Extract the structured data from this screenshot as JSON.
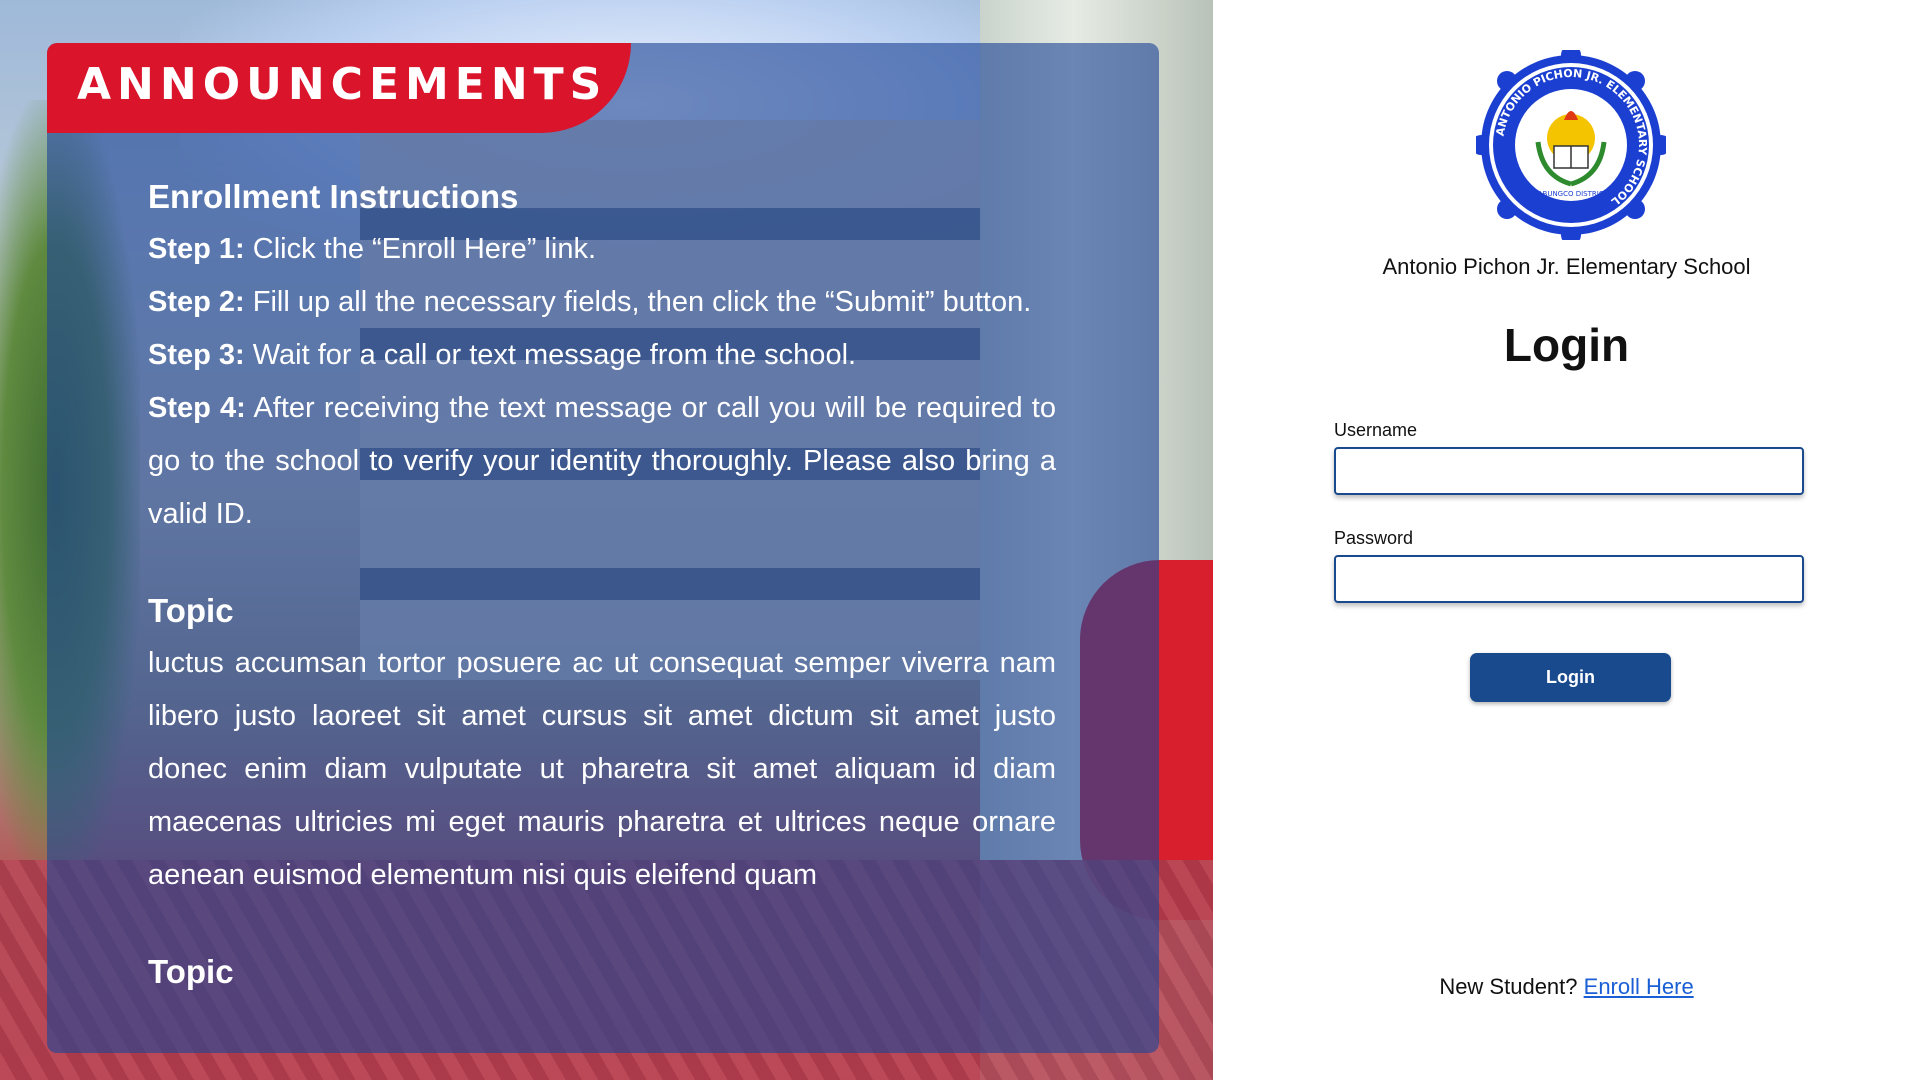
{
  "announcements": {
    "title": "ANNOUNCEMENTS",
    "enrollment": {
      "heading": "Enrollment Instructions",
      "steps": [
        {
          "label": "Step 1:",
          "text": " Click the “Enroll Here” link."
        },
        {
          "label": "Step 2:",
          "text": " Fill up all the necessary fields, then click the “Submit” button."
        },
        {
          "label": "Step 3:",
          "text": " Wait for a call or text message from the school."
        },
        {
          "label": "Step 4:",
          "text": " After receiving the text message or call you will be required to go to the school to verify your identity thoroughly. Please also bring a valid ID."
        }
      ]
    },
    "topics": [
      {
        "heading": "Topic",
        "body": "luctus accumsan tortor posuere ac ut consequat semper viverra nam libero justo laoreet sit amet cursus sit amet dictum sit amet justo donec enim diam vulputate ut pharetra sit amet aliquam id diam maecenas ultricies mi eget mauris pharetra et ultrices neque ornare aenean euismod elementum nisi quis eleifend quam"
      },
      {
        "heading": "Topic",
        "body": ""
      }
    ]
  },
  "login": {
    "logo_text": "ANTONIO PICHON JR. ELEMENTARY SCHOOL",
    "logo_subtext": "TABUNGCO DISTRICT",
    "school_name": "Antonio Pichon Jr. Elementary School",
    "heading": "Login",
    "username_label": "Username",
    "username_value": "",
    "password_label": "Password",
    "password_value": "",
    "button_label": "Login",
    "enroll_prompt": "New Student?",
    "enroll_link": "Enroll Here"
  },
  "colors": {
    "accent_blue": "#1a4a8e",
    "announce_red": "#d9142b",
    "link_blue": "#1a5fd6"
  }
}
